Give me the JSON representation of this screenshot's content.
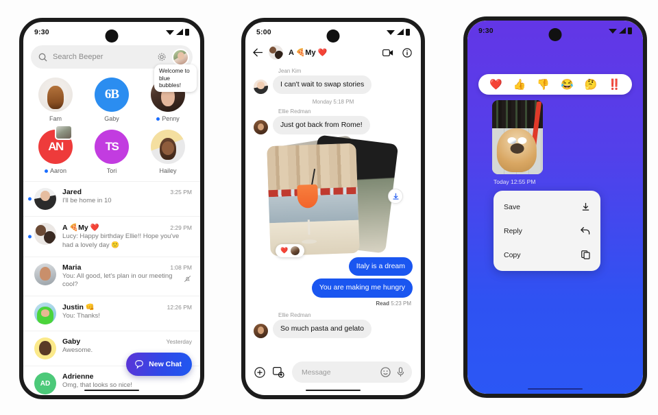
{
  "phone1": {
    "status": {
      "time": "9:30",
      "wifi": "wifi-icon",
      "signal": "signal-icon",
      "battery": "battery-icon"
    },
    "search": {
      "placeholder": "Search Beeper",
      "icon": "search-icon",
      "settings_icon": "gear-icon",
      "avatar": "profile-avatar"
    },
    "stories": [
      {
        "name": "Fam",
        "unread": false,
        "glyph": ""
      },
      {
        "name": "Gaby",
        "unread": false,
        "glyph": "6B"
      },
      {
        "name": "Penny",
        "unread": true,
        "glyph": ""
      },
      {
        "name": "Aaron",
        "unread": true,
        "glyph": "AN"
      },
      {
        "name": "Tori",
        "unread": false,
        "glyph": "TS"
      },
      {
        "name": "Hailey",
        "unread": false,
        "glyph": ""
      }
    ],
    "tooltip": "Welcome to blue bubbles!",
    "chats": [
      {
        "name": "Jared",
        "preview": "I'll be home in 10",
        "time": "3:25 PM",
        "unread": true,
        "muted": false
      },
      {
        "name": "A 🍕My ❤️",
        "preview": "Lucy: Happy birthday Ellie!! Hope you've had a lovely day  🙂",
        "time": "2:29 PM",
        "unread": true,
        "muted": false
      },
      {
        "name": "Maria",
        "preview": "You: All good, let's plan in our meeting cool?",
        "time": "1:08 PM",
        "unread": false,
        "muted": true
      },
      {
        "name": "Justin 👊",
        "preview": "You: Thanks!",
        "time": "12:26 PM",
        "unread": false,
        "muted": false
      },
      {
        "name": "Gaby",
        "preview": "Awesome.",
        "time": "Yesterday",
        "unread": false,
        "muted": false
      },
      {
        "name": "Adrienne",
        "preview": "Omg, that looks so nice!",
        "time": "",
        "unread": false,
        "muted": false,
        "initials": "AD"
      }
    ],
    "fab": {
      "label": "New Chat",
      "icon": "chat-bubble-icon"
    }
  },
  "phone2": {
    "status": {
      "time": "5:00"
    },
    "header": {
      "back_icon": "back-arrow-icon",
      "title": "A 🍕My ❤️",
      "video_icon": "video-camera-icon",
      "info_icon": "info-icon"
    },
    "messages": [
      {
        "type": "incoming",
        "sender": "Jean Kim",
        "text": "I can't wait to swap stories"
      },
      {
        "type": "daystamp",
        "text": "Monday 5:18 PM"
      },
      {
        "type": "incoming",
        "sender": "Ellie Redman",
        "text": "Just got back from Rome!"
      },
      {
        "type": "photo",
        "reaction": "❤️",
        "download_icon": "download-icon"
      },
      {
        "type": "outgoing",
        "text": "Italy is a dream"
      },
      {
        "type": "outgoing",
        "text": "You are making me hungry"
      },
      {
        "type": "readmark",
        "label": "Read",
        "time": "5:23 PM"
      },
      {
        "type": "incoming",
        "sender": "Ellie Redman",
        "text": "So much pasta and gelato"
      }
    ],
    "input": {
      "plus_icon": "plus-circle-icon",
      "camera_icon": "gallery-camera-icon",
      "placeholder": "Message",
      "emoji_icon": "emoji-smiley-icon",
      "mic_icon": "microphone-icon"
    }
  },
  "phone3": {
    "status": {
      "time": "9:30"
    },
    "reactions": [
      "❤️",
      "👍",
      "👎",
      "😂",
      "🤔",
      "‼️"
    ],
    "media_stamp": "Today  12:55 PM",
    "menu": [
      {
        "label": "Save",
        "icon": "download-icon"
      },
      {
        "label": "Reply",
        "icon": "reply-arrow-icon"
      },
      {
        "label": "Copy",
        "icon": "copy-icon"
      }
    ]
  },
  "colors": {
    "accent_blue": "#1a56f0",
    "unread_dot": "#1a6dff",
    "fab_gradient_start": "#5b34d6",
    "fab_gradient_end": "#1f58f0",
    "phone3_bg_top": "#6336e6",
    "phone3_bg_bottom": "#2b57f5",
    "bubble_in": "#eeeeee"
  }
}
